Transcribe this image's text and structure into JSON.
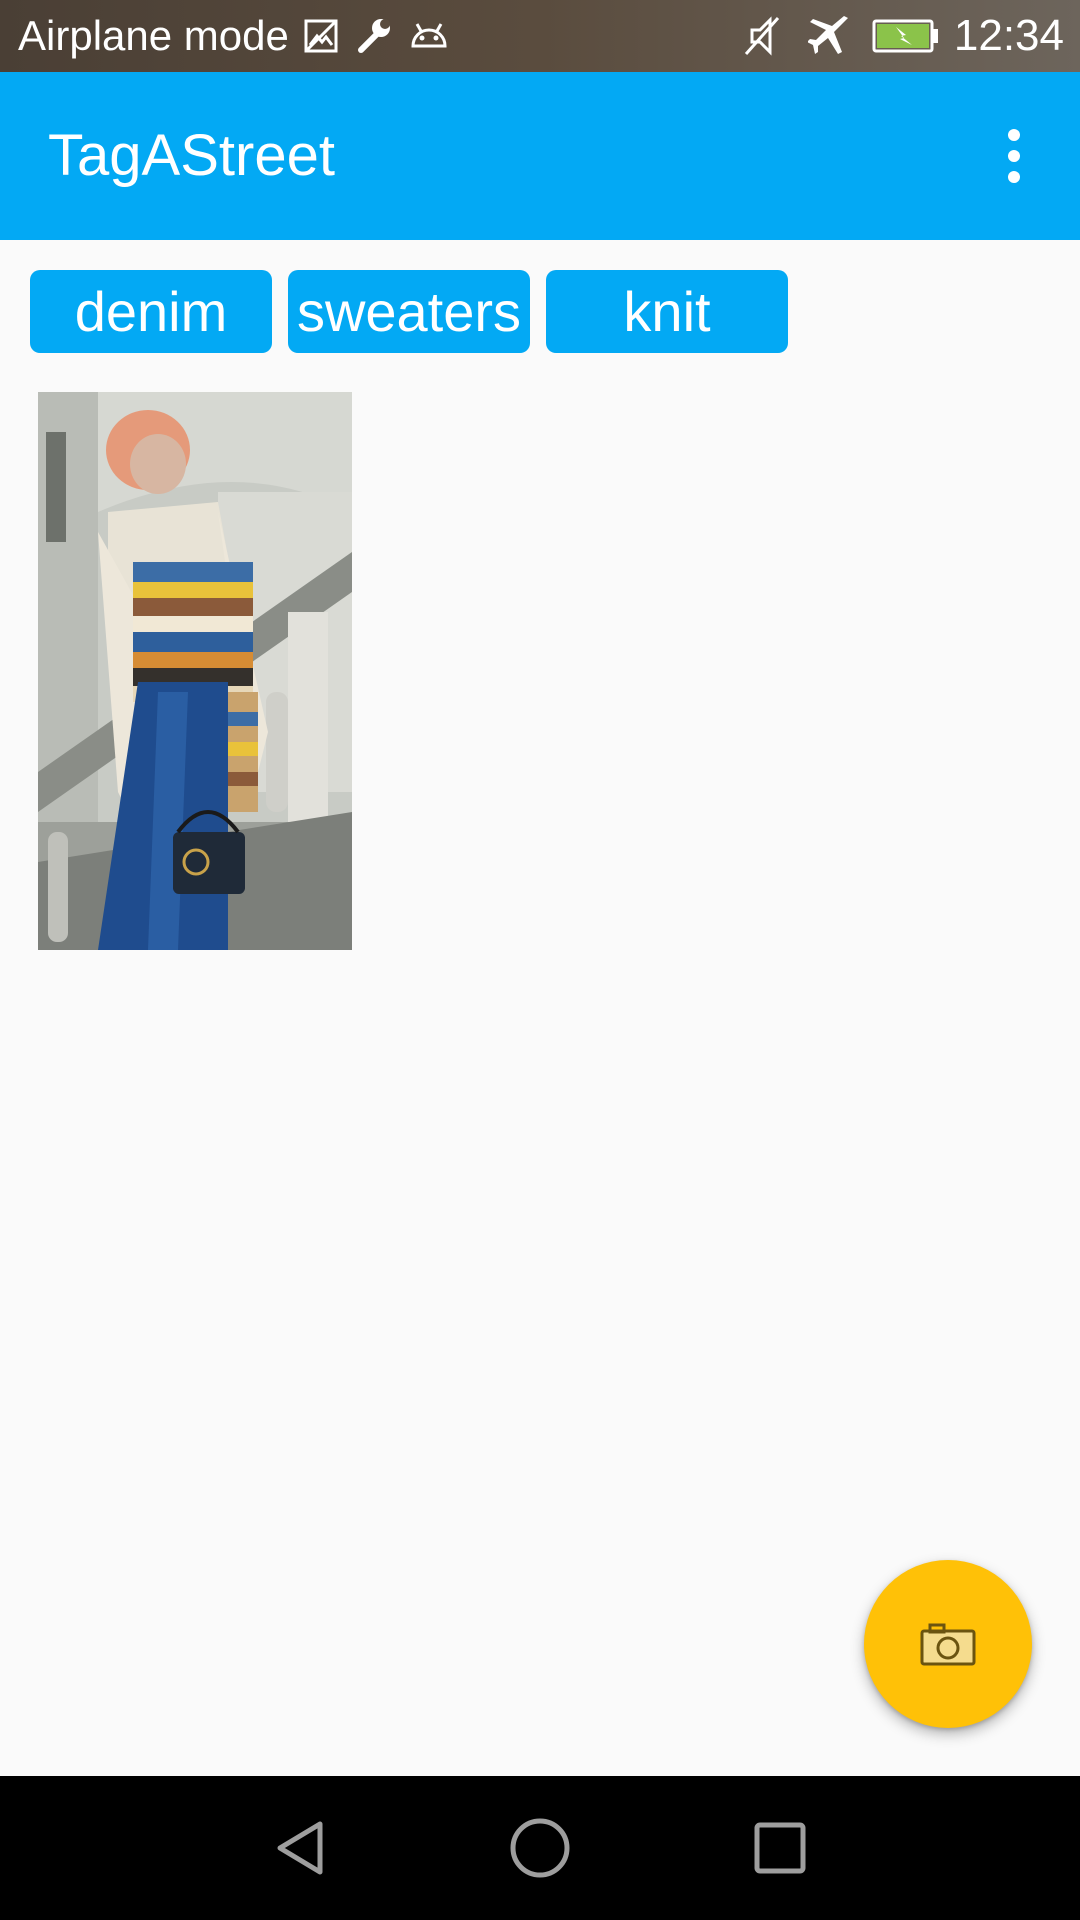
{
  "status_bar": {
    "mode_text": "Airplane mode",
    "time": "12:34",
    "left_icons": [
      "image-icon",
      "wrench-icon",
      "android-icon"
    ],
    "right_icons": [
      "vibrate-off-icon",
      "airplane-icon",
      "battery-charging-icon"
    ]
  },
  "app_bar": {
    "title": "TagAStreet",
    "menu_icon": "overflow-menu-icon"
  },
  "tags": [
    {
      "label": "denim"
    },
    {
      "label": "sweaters"
    },
    {
      "label": "knit"
    }
  ],
  "fab": {
    "icon": "camera-icon"
  },
  "nav_bar": {
    "icons": [
      "back-icon",
      "home-icon",
      "recents-icon"
    ]
  },
  "colors": {
    "primary": "#03a9f4",
    "accent": "#ffc107",
    "background": "#fafafa",
    "nav_background": "#000000"
  }
}
